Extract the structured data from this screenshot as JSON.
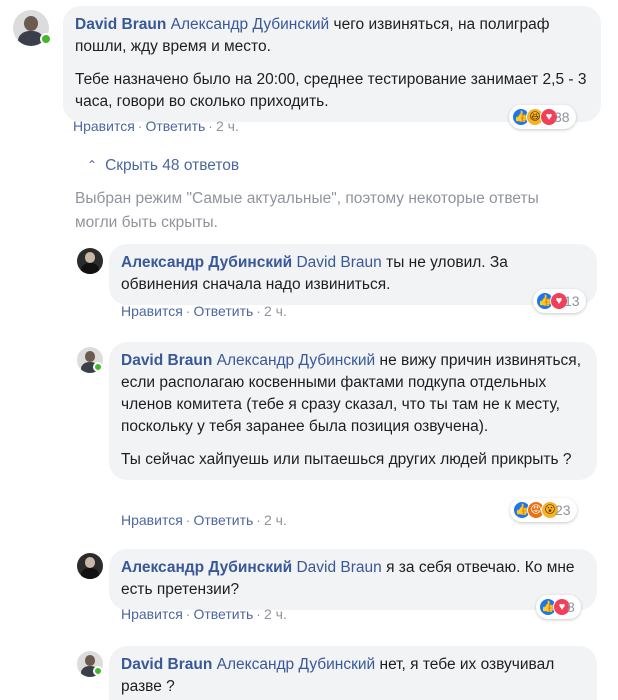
{
  "thread": {
    "toggle_label": "Скрыть 48 ответов",
    "notice": "Выбран режим \"Самые актуальные\", поэтому некоторые ответы могли быть скрыты."
  },
  "comments": [
    {
      "author": "David Braun",
      "mention": "Александр Дубинский",
      "text": "чего извиняться, на полиграф пошли, жду время и место.",
      "text2": "Тебе назначено было на 20:00, среднее тестирование занимает 2,5 - 3 часа, говори во сколько приходить.",
      "like": "Нравится",
      "reply": "Ответить",
      "time": "2 ч.",
      "reaction_count": "38",
      "reaction_icons": [
        "like-icon",
        "haha-icon",
        "love-icon"
      ]
    },
    {
      "author": "Александр Дубинский",
      "mention": "David Braun",
      "text": "ты не уловил. За обвинения сначала надо извиниться.",
      "like": "Нравится",
      "reply": "Ответить",
      "time": "2 ч.",
      "reaction_count": "13",
      "reaction_icons": [
        "like-icon",
        "love-icon"
      ]
    },
    {
      "author": "David Braun",
      "mention": "Александр Дубинский",
      "text": "не вижу причин извиняться, если располагаю косвенными фактами подкупа отдельных членов комитета (тебе я сразу сказал, что ты там не к месту, поскольку у тебя заранее была позиция озвучена).",
      "text2": "Ты сейчас хайпуешь или пытаешься других людей прикрыть ?",
      "like": "Нравится",
      "reply": "Ответить",
      "time": "2 ч.",
      "reaction_count": "23",
      "reaction_icons": [
        "like-icon",
        "angry-icon",
        "wow-icon"
      ]
    },
    {
      "author": "Александр Дубинский",
      "mention": "David Braun",
      "text": "я за себя отвечаю. Ко мне есть претензии?",
      "like": "Нравится",
      "reply": "Ответить",
      "time": "2 ч.",
      "reaction_count": "8",
      "reaction_icons": [
        "like-icon",
        "love-icon"
      ]
    },
    {
      "author": "David Braun",
      "mention": "Александр Дубинский",
      "text": "нет, я тебе их озвучивал разве ?"
    }
  ]
}
